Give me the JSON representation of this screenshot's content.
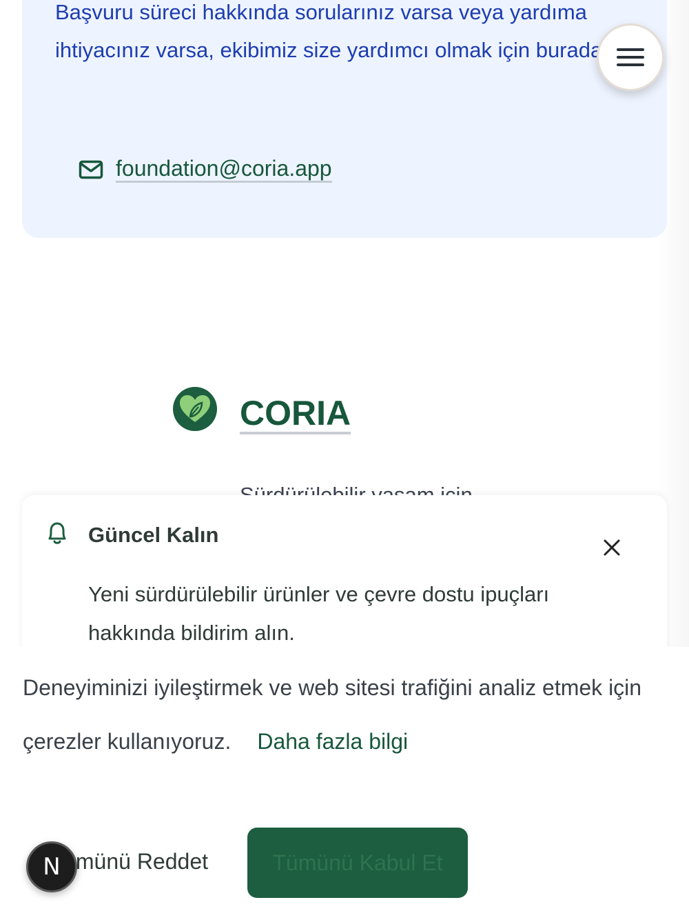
{
  "help": {
    "text": "Başvuru süreci hakkında sorularınız varsa veya yardıma ihtiyacınız varsa, ekibimiz size yardımcı olmak için burada.",
    "email": "foundation@coria.app",
    "email_icon": "mail-icon"
  },
  "menu": {
    "icon": "hamburger-menu-icon"
  },
  "brand": {
    "name": "CORIA",
    "logo_icon": "heart-leaf-logo",
    "tagline_partial": "Sürdürülebilir yaşam için"
  },
  "notification": {
    "icon": "bell-icon",
    "title": "Güncel Kalın",
    "body": "Yeni sürdürülebilir ürünler ve çevre dostu ipuçları hakkında bildirim alın.",
    "close_icon": "close-icon"
  },
  "cookie": {
    "text": "Deneyiminizi iyileştirmek ve web sitesi trafiğini analiz etmek için çerezler kullanıyoruz.",
    "learn_more": "Daha fazla bilgi",
    "reject_label": "Tümünü Reddet",
    "accept_label": "Tümünü Kabul Et"
  },
  "dev_badge": {
    "label": "N"
  },
  "colors": {
    "brand_green": "#17573b",
    "accept_green": "#1c5e3f",
    "help_blue": "#1d3db0",
    "help_bg": "#eef4ff"
  }
}
